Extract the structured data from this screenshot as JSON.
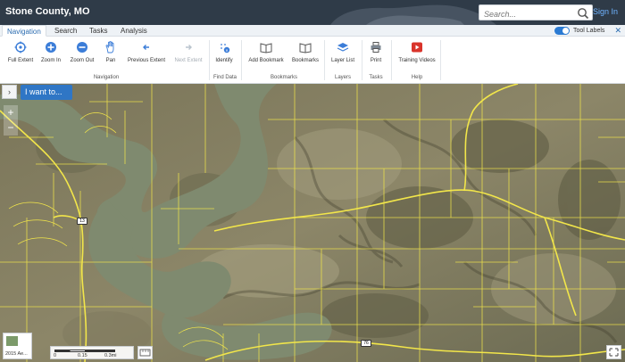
{
  "header": {
    "title": "Stone County, MO",
    "search_placeholder": "Search...",
    "sign_in": "Sign In"
  },
  "tabs": [
    {
      "label": "Navigation",
      "active": true
    },
    {
      "label": "Search",
      "active": false
    },
    {
      "label": "Tasks",
      "active": false
    },
    {
      "label": "Analysis",
      "active": false
    }
  ],
  "tool_labels": {
    "label": "Tool Labels",
    "enabled": true
  },
  "ribbon": {
    "tools": {
      "full_extent": "Full Extent",
      "zoom_in": "Zoom In",
      "zoom_out": "Zoom Out",
      "pan": "Pan",
      "previous_extent": "Previous Extent",
      "next_extent": "Next Extent",
      "identify": "Identify",
      "add_bookmark": "Add Bookmark",
      "bookmarks": "Bookmarks",
      "layer_list": "Layer List",
      "print": "Print",
      "training_videos": "Training Videos"
    },
    "groups": {
      "navigation": "Navigation",
      "find_data": "Find Data",
      "bookmarks": "Bookmarks",
      "layers": "Layers",
      "tasks": "Tasks",
      "help": "Help"
    }
  },
  "map": {
    "i_want_to": "I want to...",
    "basemap_label": "2015 Ae...",
    "scale": {
      "t0": "0",
      "t1": "0.15",
      "t2": "0.3mi"
    },
    "shields": {
      "a": "13",
      "b": "76"
    }
  },
  "colors": {
    "header_bg": "#2f3b48",
    "accent": "#2f76c5",
    "parcel_lines": "#f2e64a",
    "water": "#7f8a6f"
  }
}
